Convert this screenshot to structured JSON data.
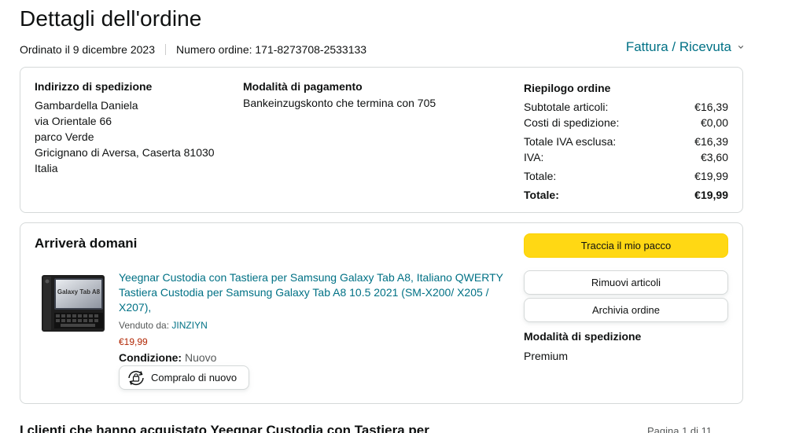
{
  "page": {
    "title": "Dettagli dell'ordine",
    "ordered_on": "Ordinato il 9 dicembre 2023",
    "order_number": "Numero ordine: 171-8273708-2533133",
    "invoice_link": "Fattura / Ricevuta"
  },
  "shipping_address": {
    "heading": "Indirizzo di spedizione",
    "lines": [
      "Gambardella Daniela",
      "via Orientale 66",
      "parco Verde",
      "Gricignano di Aversa, Caserta 81030",
      "Italia"
    ]
  },
  "payment": {
    "heading": "Modalità di pagamento",
    "method": "Bankeinzugskonto che termina con 705"
  },
  "summary": {
    "heading": "Riepilogo ordine",
    "rows": [
      {
        "label": "Subtotale articoli:",
        "value": "€16,39"
      },
      {
        "label": "Costi di spedizione:",
        "value": "€0,00"
      },
      {
        "label": "Totale IVA esclusa:",
        "value": "€16,39"
      },
      {
        "label": "IVA:",
        "value": "€3,60"
      },
      {
        "label": "Totale:",
        "value": "€19,99"
      },
      {
        "label": "Totale:",
        "value": "€19,99"
      }
    ]
  },
  "shipment": {
    "status": "Arriverà domani",
    "product_title": "Yeegnar Custodia con Tastiera per Samsung Galaxy Tab A8, Italiano QWERTY Tastiera Custodia per Samsung Galaxy Tab A8 10.5 2021 (SM-X200/ X205 / X207),",
    "sold_by_label": "Venduto da:",
    "seller": "JINZIYN",
    "price": "€19,99",
    "condition_label": "Condizione:",
    "condition_value": "Nuovo",
    "buy_again": "Compralo di nuovo",
    "thumb_text": "Galaxy Tab A8",
    "track_button": "Traccia il mio pacco",
    "remove_button": "Rimuovi articoli",
    "archive_button": "Archivia ordine",
    "shipping_method_heading": "Modalità di spedizione",
    "shipping_method": "Premium"
  },
  "bottom": {
    "title": "I clienti che hanno acquistato Yeegnar Custodia con Tastiera per",
    "page_count": "Pagina 1 di 11"
  },
  "colors": {
    "link": "#007185",
    "price": "#b12704",
    "primary_button": "#ffd814",
    "border": "#d5d9d9"
  }
}
